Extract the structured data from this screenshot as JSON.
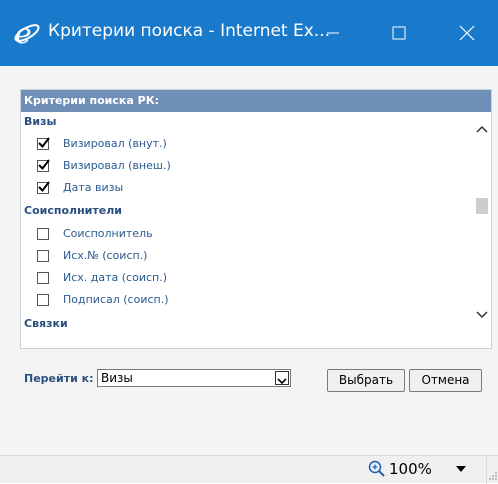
{
  "window": {
    "title": "Критерии поиска - Internet Ex..."
  },
  "panel": {
    "header": "Критерии поиска РК:",
    "groups": [
      {
        "title": "Визы",
        "items": [
          {
            "label": "Визировал (внут.)",
            "checked": true
          },
          {
            "label": "Визировал (внеш.)",
            "checked": true
          },
          {
            "label": "Дата визы",
            "checked": true
          }
        ]
      },
      {
        "title": "Соисполнители",
        "items": [
          {
            "label": "Соисполнитель",
            "checked": false
          },
          {
            "label": "Исх.№ (соисп.)",
            "checked": false
          },
          {
            "label": "Исх. дата (соисп.)",
            "checked": false
          },
          {
            "label": "Подписал (соисп.)",
            "checked": false
          }
        ]
      },
      {
        "title": "Связки",
        "items": []
      }
    ]
  },
  "goto": {
    "label": "Перейти к:",
    "selected": "Визы"
  },
  "buttons": {
    "select": "Выбрать",
    "cancel": "Отмена"
  },
  "status": {
    "zoom": "100%"
  },
  "colors": {
    "titlebar": "#1979ca",
    "panel_header": "#6f8fb7",
    "group_title": "#2b4f80",
    "item_label": "#2b5a90"
  },
  "icons": [
    "ie-logo-icon",
    "minimize-icon",
    "maximize-icon",
    "close-icon",
    "checkbox-icon",
    "scroll-up-icon",
    "scroll-down-icon",
    "dropdown-arrow-icon",
    "zoom-icon",
    "resize-grip-icon"
  ]
}
